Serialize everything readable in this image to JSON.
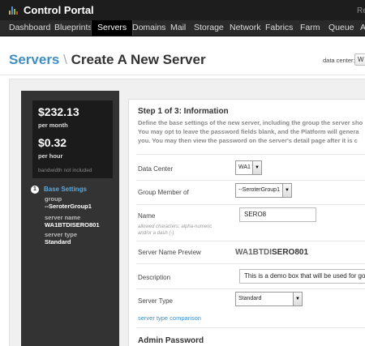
{
  "app": {
    "title": "Control Portal",
    "topbar_right": "Re"
  },
  "nav": {
    "items": [
      "Dashboard",
      "Blueprints",
      "Servers",
      "Domains",
      "Mail",
      "Storage",
      "Network",
      "Fabrics",
      "Farm",
      "Queue",
      "A"
    ],
    "active": "Servers"
  },
  "header": {
    "section": "Servers",
    "separator": "\\",
    "title": "Create A New Server",
    "dc_label": "data center:",
    "dc_value": "W"
  },
  "pricing": {
    "monthly": "$232.13",
    "monthly_label": "per month",
    "hourly": "$0.32",
    "hourly_label": "per hour",
    "bandwidth_note": "bandwidth not included"
  },
  "summary": {
    "step_number": "1",
    "step_title": "Base Settings",
    "group_label": "group",
    "group_value": "--SeroterGroup1",
    "server_name_label": "server name",
    "server_name_prefix": "WA1BTDI",
    "server_name_value": "SERO801",
    "server_type_label": "server type",
    "server_type_value": "Standard"
  },
  "form": {
    "heading": "Step 1 of 3: Information",
    "description": [
      "Define the base settings of the new server, including the group the server sho",
      "You may opt to leave the password fields blank, and the Platform will genera",
      "you. You may then view the password on the server's detail page after it is c"
    ],
    "data_center_label": "Data Center",
    "data_center_value": "WA1",
    "group_member_label": "Group Member of",
    "group_member_value": "--SeroterGroup1",
    "name_label": "Name",
    "name_value": "SERO8",
    "name_hint": "allowed characters: alpha-numeric and/or a dash (-)",
    "preview_label": "Server Name Preview",
    "preview_prefix": "WA1BTDI",
    "preview_suffix": "SERO801",
    "description_label": "Description",
    "description_value": "This is a demo box that will be used for good.",
    "server_type_label": "Server Type",
    "server_type_value": "Standard",
    "server_type_link": "server type comparison",
    "admin_heading": "Admin Password"
  },
  "colors": {
    "accent": "#3e8ec2",
    "topbar": "#1d1d1d",
    "panel": "#333333"
  }
}
